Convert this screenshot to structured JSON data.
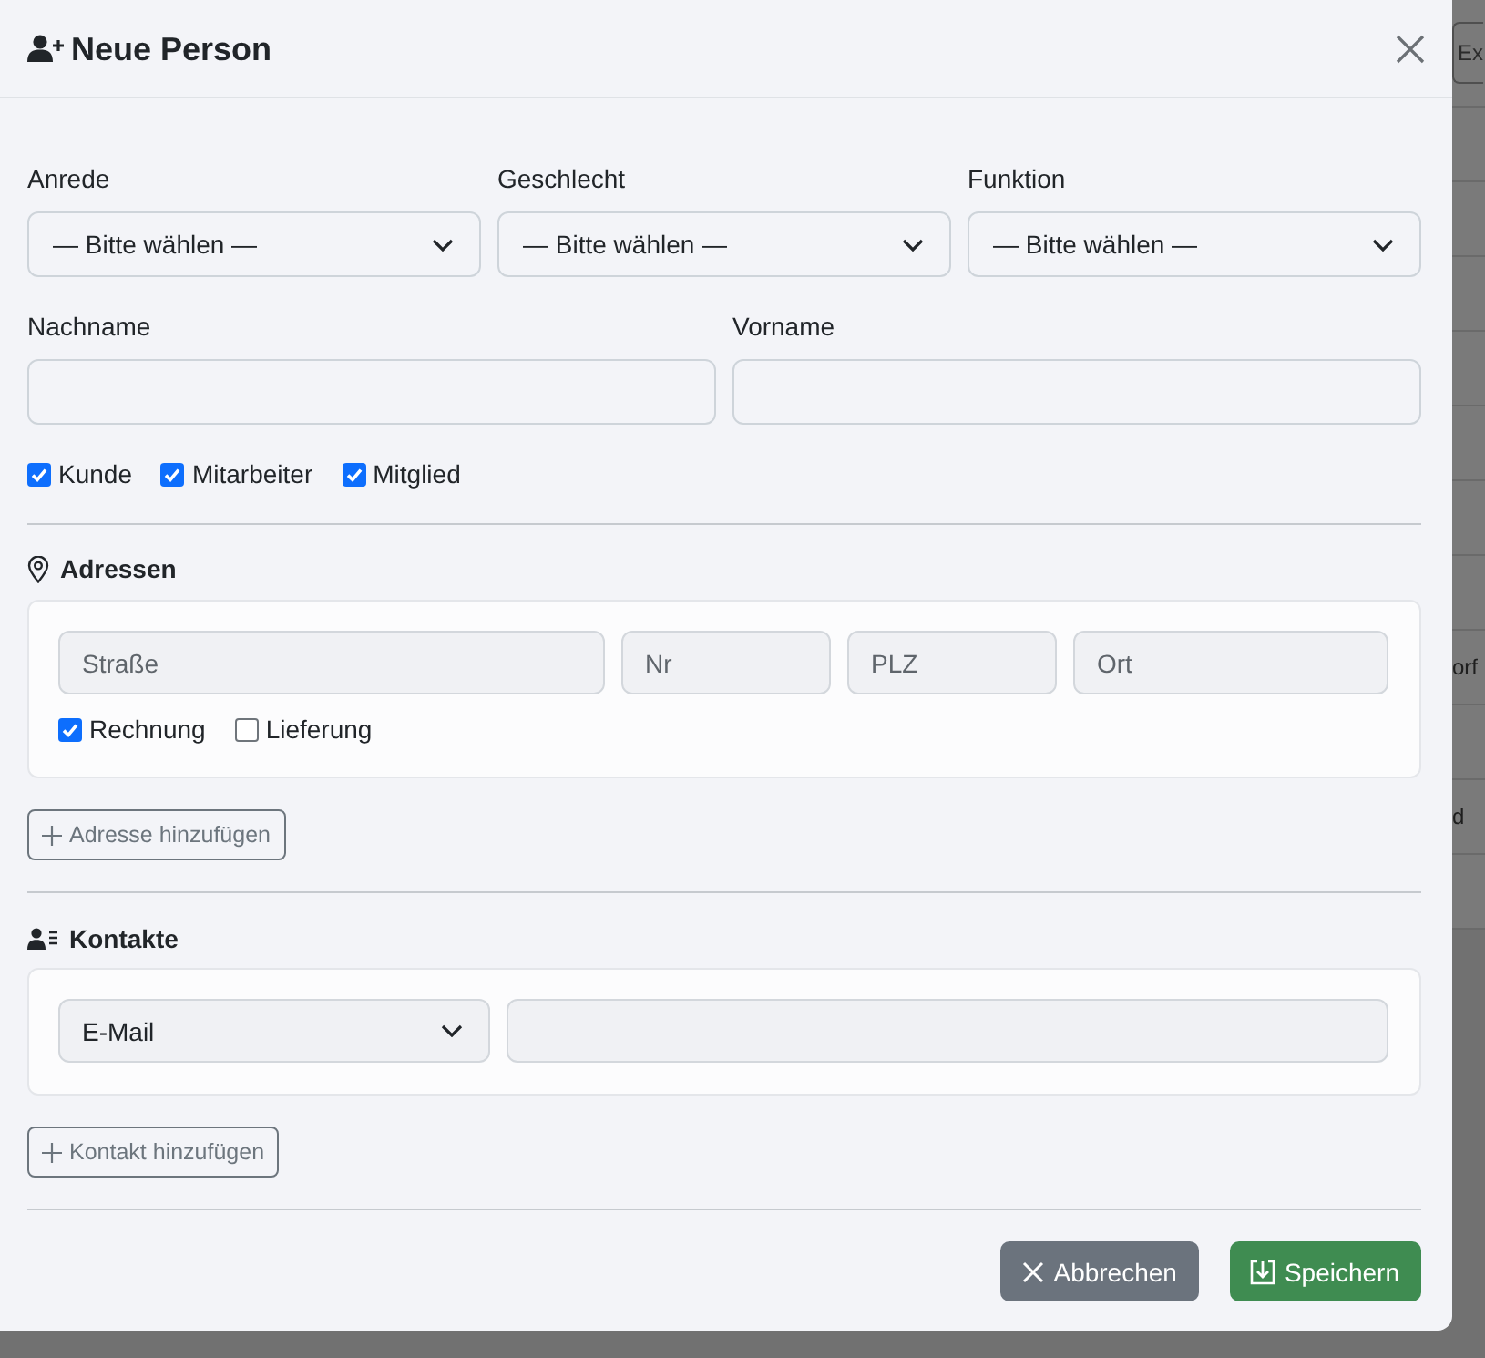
{
  "dialog": {
    "title": "Neue Person"
  },
  "selects": [
    {
      "label": "Anrede",
      "value": "— Bitte wählen —"
    },
    {
      "label": "Geschlecht",
      "value": "— Bitte wählen —"
    },
    {
      "label": "Funktion",
      "value": "— Bitte wählen —"
    }
  ],
  "name_fields": [
    {
      "label": "Nachname"
    },
    {
      "label": "Vorname"
    }
  ],
  "roles": [
    {
      "label": "Kunde",
      "checked": true
    },
    {
      "label": "Mitarbeiter",
      "checked": true
    },
    {
      "label": "Mitglied",
      "checked": true
    }
  ],
  "addresses": {
    "title": "Adressen",
    "fields": [
      {
        "placeholder": "Straße"
      },
      {
        "placeholder": "Nr"
      },
      {
        "placeholder": "PLZ"
      },
      {
        "placeholder": "Ort"
      }
    ],
    "types": [
      {
        "label": "Rechnung",
        "checked": true
      },
      {
        "label": "Lieferung",
        "checked": false
      }
    ],
    "add_button": "Adresse hinzufügen"
  },
  "contacts": {
    "title": "Kontakte",
    "entries": [
      {
        "type": "E-Mail"
      }
    ],
    "add_button": "Kontakt hinzufügen"
  },
  "footer": {
    "buttons": [
      {
        "kind": "cancel",
        "label": "Abbrechen"
      },
      {
        "kind": "save",
        "label": "Speichern"
      }
    ]
  },
  "backdrop": {
    "button": "Ex",
    "cells": [
      "orf",
      "d"
    ]
  }
}
